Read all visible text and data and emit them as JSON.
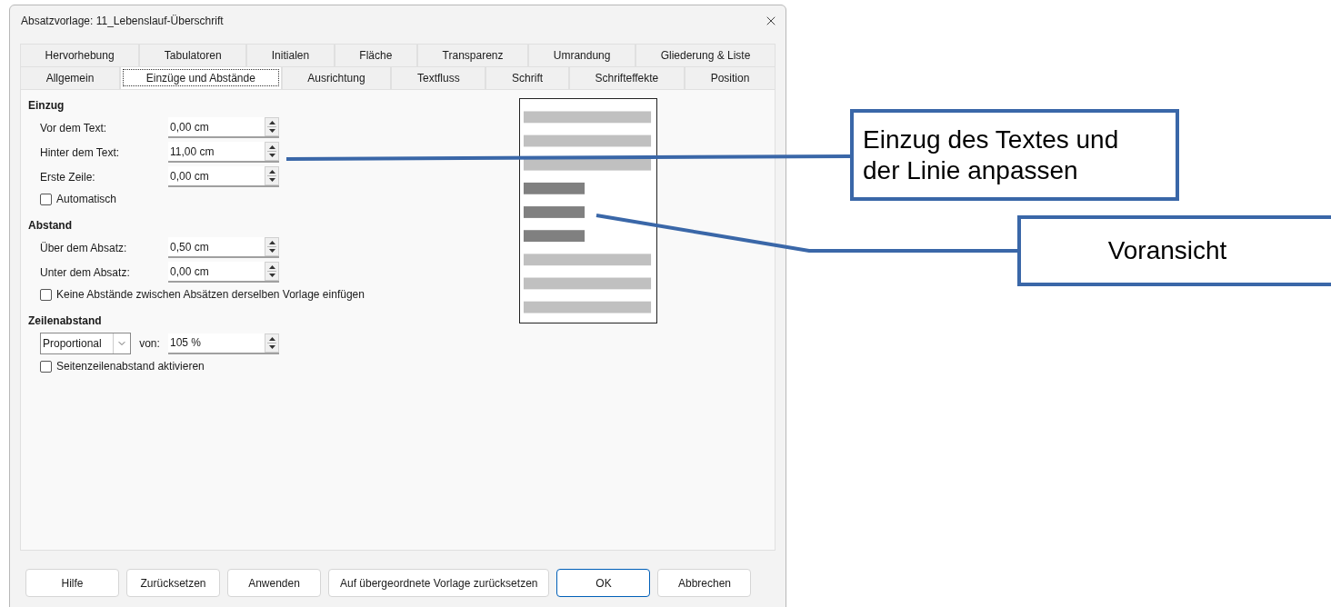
{
  "window": {
    "title": "Absatzvorlage: 11_Lebenslauf-Überschrift"
  },
  "tab_rows": [
    [
      {
        "label": "Hervorhebung",
        "selected": false
      },
      {
        "label": "Tabulatoren",
        "selected": false
      },
      {
        "label": "Initialen",
        "selected": false
      },
      {
        "label": "Fläche",
        "selected": false
      },
      {
        "label": "Transparenz",
        "selected": false
      },
      {
        "label": "Umrandung",
        "selected": false
      },
      {
        "label": "Gliederung & Liste",
        "selected": false
      }
    ],
    [
      {
        "label": "Allgemein",
        "selected": false
      },
      {
        "label": "Einzüge und Abstände",
        "selected": true
      },
      {
        "label": "Ausrichtung",
        "selected": false
      },
      {
        "label": "Textfluss",
        "selected": false
      },
      {
        "label": "Schrift",
        "selected": false
      },
      {
        "label": "Schrifteffekte",
        "selected": false
      },
      {
        "label": "Position",
        "selected": false
      }
    ]
  ],
  "sections": [
    {
      "heading": "Einzug",
      "rows": [
        {
          "kind": "spin",
          "label": "Vor dem Text:",
          "value": "0,00 cm"
        },
        {
          "kind": "spin",
          "label": "Hinter dem Text:",
          "value": "11,00 cm"
        },
        {
          "kind": "spin",
          "label": "Erste Zeile:",
          "value": "0,00 cm"
        },
        {
          "kind": "checkbox",
          "label": "Automatisch",
          "checked": false
        }
      ]
    },
    {
      "heading": "Abstand",
      "rows": [
        {
          "kind": "spin",
          "label": "Über dem Absatz:",
          "value": "0,50 cm"
        },
        {
          "kind": "spin",
          "label": "Unter dem Absatz:",
          "value": "0,00 cm"
        },
        {
          "kind": "checkbox",
          "label": "Keine Abstände zwischen Absätzen derselben Vorlage einfügen",
          "checked": false
        }
      ]
    },
    {
      "heading": "Zeilenabstand",
      "rows": [
        {
          "kind": "select",
          "dropdown": {
            "value": "Proportional"
          },
          "spin": {
            "label": "von:",
            "value": "105 %"
          }
        },
        {
          "kind": "checkbox",
          "label": "Seitenzeilenabstand aktivieren",
          "checked": false
        }
      ]
    }
  ],
  "buttons": [
    {
      "label": "Hilfe",
      "default": false
    },
    {
      "label": "Zurücksetzen",
      "default": false
    },
    {
      "label": "Anwenden",
      "default": false
    },
    {
      "label": "Auf übergeordnete Vorlage zurücksetzen",
      "default": false
    },
    {
      "label": "OK",
      "default": true
    },
    {
      "label": "Abbrechen",
      "default": false
    }
  ],
  "callouts": [
    {
      "lines": [
        "Einzug des Textes und",
        "der Linie anpassen"
      ]
    },
    {
      "lines": [
        "Voransicht"
      ]
    }
  ]
}
